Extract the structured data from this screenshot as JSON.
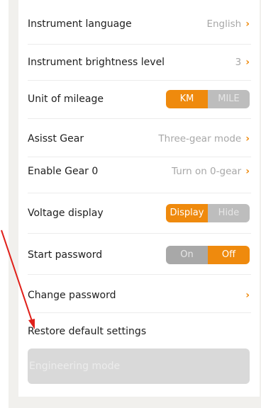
{
  "settings": {
    "instrument_language": {
      "label": "Instrument language",
      "value": "English"
    },
    "brightness": {
      "label": "Instrument brightness level",
      "value": "3"
    },
    "mileage_unit": {
      "label": "Unit of mileage",
      "options": [
        "KM",
        "MILE"
      ],
      "selected": "KM"
    },
    "assist_gear": {
      "label": "Asisst Gear",
      "value": "Three-gear mode"
    },
    "gear_zero": {
      "label": "Enable Gear 0",
      "value": "Turn on 0-gear"
    },
    "voltage_display": {
      "label": "Voltage display",
      "options": [
        "Display",
        "Hide"
      ],
      "selected": "Display"
    },
    "start_password": {
      "label": "Start password",
      "options": [
        "On",
        "Off"
      ],
      "selected": "Off"
    },
    "change_password": {
      "label": "Change password"
    },
    "restore_defaults": {
      "label": "Restore default settings"
    },
    "engineering_mode": {
      "label": "Engineering mode"
    }
  },
  "colors": {
    "accent": "#ef8a0d",
    "annotation_arrow": "#e0201a"
  },
  "icons": {
    "chevron": "chevron-right-icon"
  }
}
